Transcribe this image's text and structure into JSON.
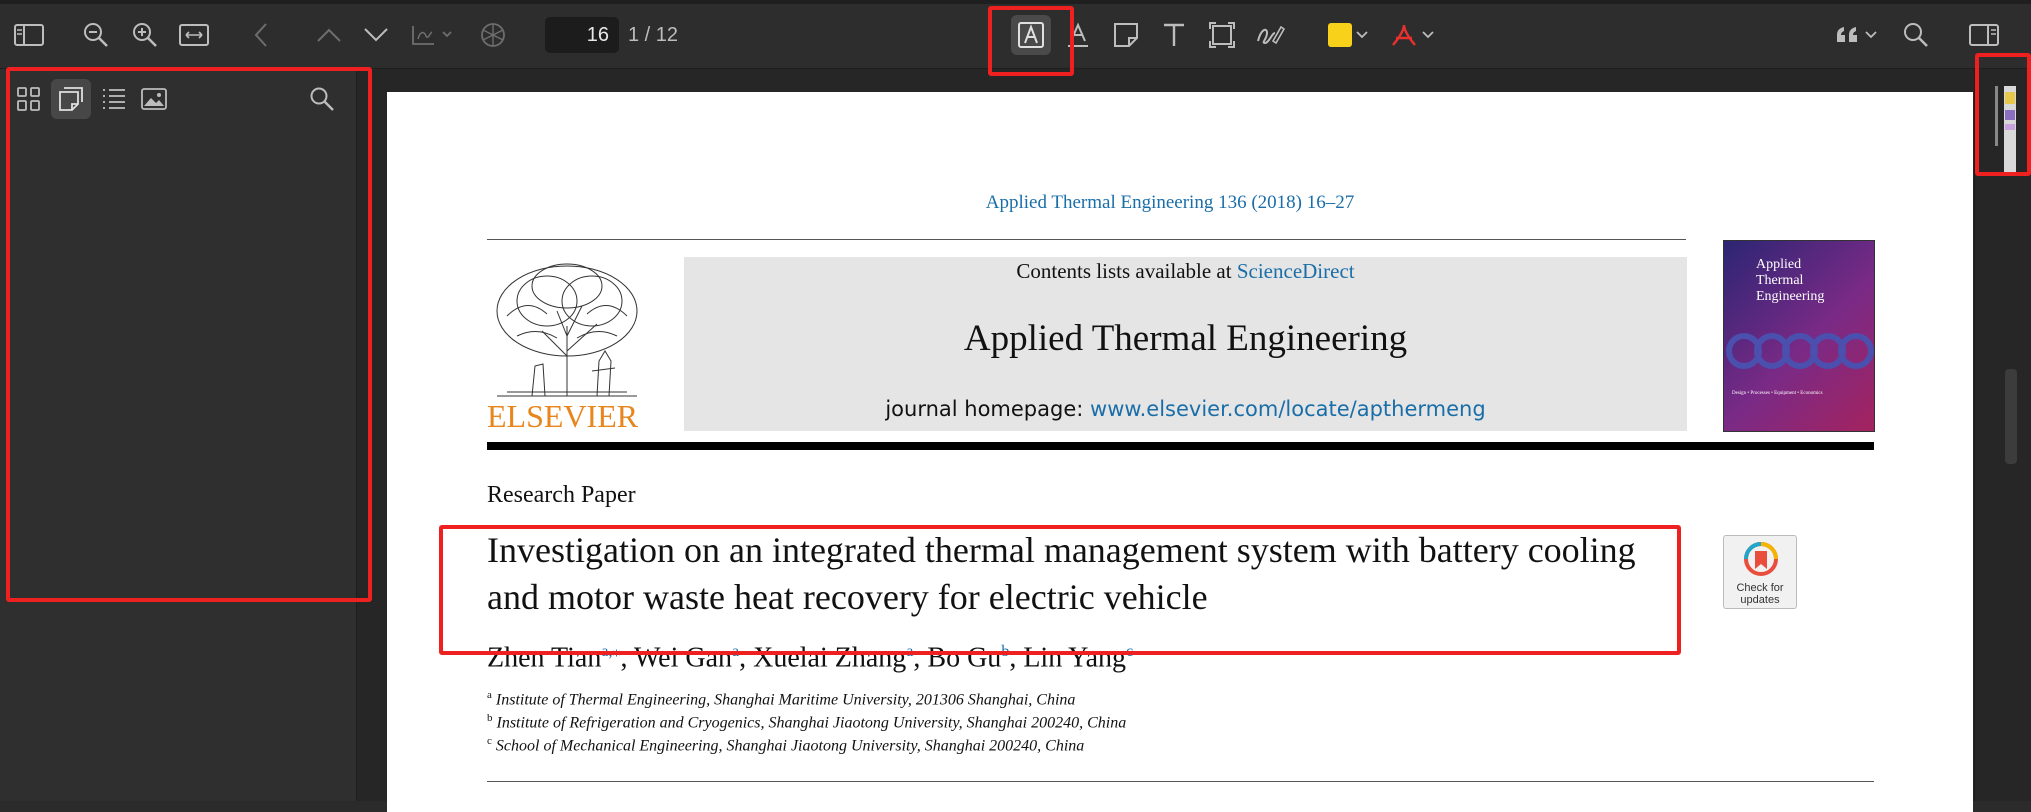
{
  "toolbar": {
    "page_number": "16",
    "page_total": "1 / 12",
    "icons_left": [
      "sidebar-toggle-icon",
      "zoom-out-icon",
      "zoom-in-icon",
      "fit-width-icon",
      "back-icon",
      "previous-page-icon",
      "next-page-icon",
      "pdf-tools-icon",
      "openai-icon"
    ],
    "icons_center": [
      "text-box-icon",
      "underline-text-icon",
      "note-icon",
      "text-icon",
      "selection-icon",
      "signature-icon"
    ],
    "highlight_color": "#f8d21a",
    "acrobat_color": "#e8312f",
    "icons_right": [
      "quote-icon",
      "search-icon",
      "inspector-panel-icon"
    ]
  },
  "sidebar": {
    "tabs": [
      "thumbnails-icon",
      "annotations-icon",
      "outline-icon",
      "images-icon"
    ],
    "active_tab": "annotations-icon",
    "search_icon": "search-icon"
  },
  "document": {
    "citation": "Applied Thermal Engineering 136 (2018) 16–27",
    "contents_prefix": "Contents lists available at ",
    "contents_link": "ScienceDirect",
    "journal_title": "Applied Thermal Engineering",
    "homepage_prefix": "journal homepage: ",
    "homepage_link": "www.elsevier.com/locate/apthermeng",
    "publisher": "ELSEVIER",
    "cover_title_1": "Applied",
    "cover_title_2": "Thermal",
    "cover_title_3": "Engineering",
    "cover_footer": "Design • Processes • Equipment • Economics",
    "section_label": "Research Paper",
    "title": "Investigation on an integrated thermal management system with battery cooling and motor waste heat recovery for electric vehicle",
    "check_badge": "Check for updates",
    "authors": [
      {
        "name": "Zhen Tian",
        "sup": "a,⁎"
      },
      {
        "name": "Wei Gan",
        "sup": "a"
      },
      {
        "name": "Xuelai Zhang",
        "sup": "a"
      },
      {
        "name": "Bo Gu",
        "sup": "b"
      },
      {
        "name": "Lin Yang",
        "sup": "c"
      }
    ],
    "affiliations": [
      {
        "mark": "a",
        "text": "Institute of Thermal Engineering, Shanghai Maritime University, 201306 Shanghai, China"
      },
      {
        "mark": "b",
        "text": "Institute of Refrigeration and Cryogenics, Shanghai Jiaotong University, Shanghai 200240, China"
      },
      {
        "mark": "c",
        "text": "School of Mechanical Engineering, Shanghai Jiaotong University, Shanghai 200240, China"
      }
    ]
  },
  "colors": {
    "annotation_red": "#ee2020",
    "link_blue": "#1a6ea8",
    "elsevier_orange": "#e8851d"
  }
}
